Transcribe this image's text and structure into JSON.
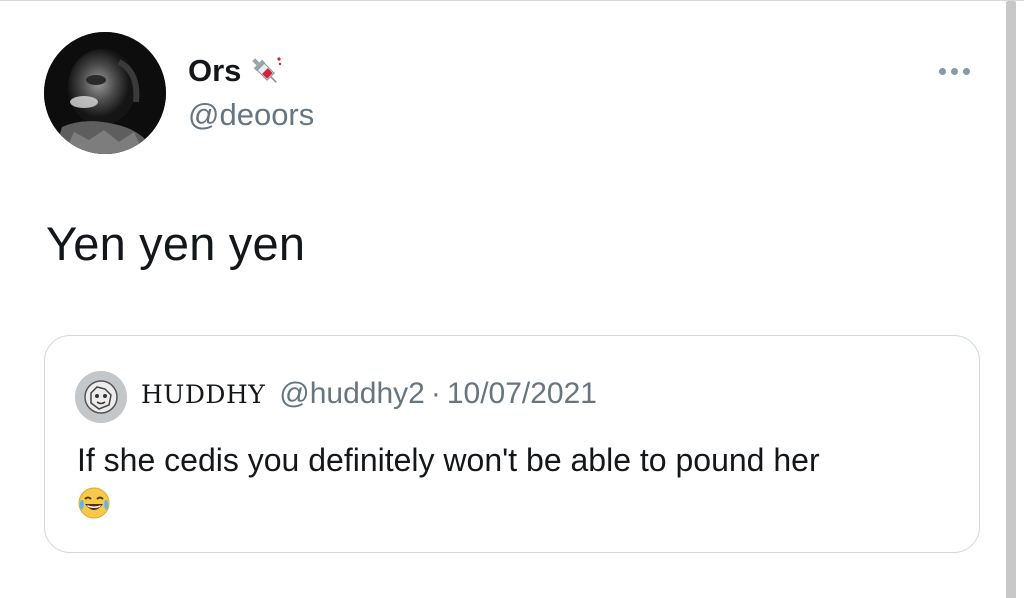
{
  "author": {
    "display_name": "Ors",
    "handle": "@deoors",
    "name_emoji": "syringe-icon"
  },
  "tweet": {
    "text": "Yen yen yen"
  },
  "more_icon": "more-icon",
  "quoted_tweet": {
    "display_name": "HUDDHY",
    "handle": "@huddhy2",
    "separator": "·",
    "date": "10/07/2021",
    "text": "If she cedis you definitely won't be able to pound her",
    "emoji": "face-with-tears-of-joy-icon"
  },
  "colors": {
    "text_primary": "#14171a",
    "text_secondary": "#66757f",
    "border": "#cfd9de"
  }
}
